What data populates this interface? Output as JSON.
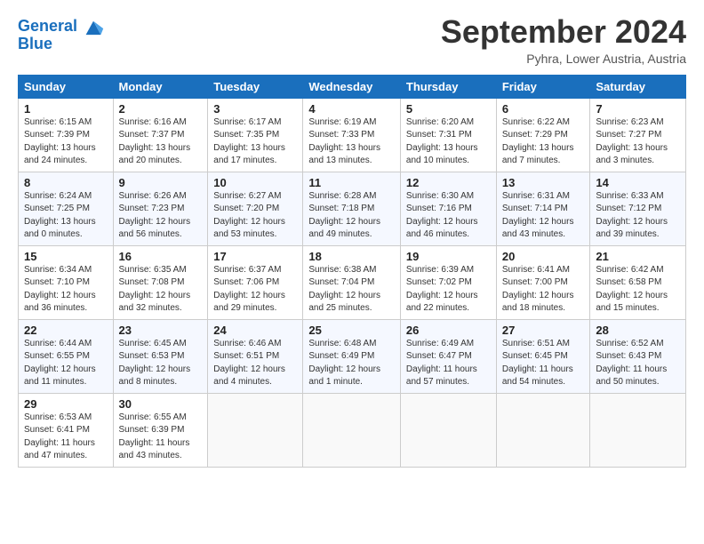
{
  "header": {
    "logo_line1": "General",
    "logo_line2": "Blue",
    "month_title": "September 2024",
    "location": "Pyhra, Lower Austria, Austria"
  },
  "columns": [
    "Sunday",
    "Monday",
    "Tuesday",
    "Wednesday",
    "Thursday",
    "Friday",
    "Saturday"
  ],
  "weeks": [
    [
      {
        "day": "1",
        "info": "Sunrise: 6:15 AM\nSunset: 7:39 PM\nDaylight: 13 hours\nand 24 minutes."
      },
      {
        "day": "2",
        "info": "Sunrise: 6:16 AM\nSunset: 7:37 PM\nDaylight: 13 hours\nand 20 minutes."
      },
      {
        "day": "3",
        "info": "Sunrise: 6:17 AM\nSunset: 7:35 PM\nDaylight: 13 hours\nand 17 minutes."
      },
      {
        "day": "4",
        "info": "Sunrise: 6:19 AM\nSunset: 7:33 PM\nDaylight: 13 hours\nand 13 minutes."
      },
      {
        "day": "5",
        "info": "Sunrise: 6:20 AM\nSunset: 7:31 PM\nDaylight: 13 hours\nand 10 minutes."
      },
      {
        "day": "6",
        "info": "Sunrise: 6:22 AM\nSunset: 7:29 PM\nDaylight: 13 hours\nand 7 minutes."
      },
      {
        "day": "7",
        "info": "Sunrise: 6:23 AM\nSunset: 7:27 PM\nDaylight: 13 hours\nand 3 minutes."
      }
    ],
    [
      {
        "day": "8",
        "info": "Sunrise: 6:24 AM\nSunset: 7:25 PM\nDaylight: 13 hours\nand 0 minutes."
      },
      {
        "day": "9",
        "info": "Sunrise: 6:26 AM\nSunset: 7:23 PM\nDaylight: 12 hours\nand 56 minutes."
      },
      {
        "day": "10",
        "info": "Sunrise: 6:27 AM\nSunset: 7:20 PM\nDaylight: 12 hours\nand 53 minutes."
      },
      {
        "day": "11",
        "info": "Sunrise: 6:28 AM\nSunset: 7:18 PM\nDaylight: 12 hours\nand 49 minutes."
      },
      {
        "day": "12",
        "info": "Sunrise: 6:30 AM\nSunset: 7:16 PM\nDaylight: 12 hours\nand 46 minutes."
      },
      {
        "day": "13",
        "info": "Sunrise: 6:31 AM\nSunset: 7:14 PM\nDaylight: 12 hours\nand 43 minutes."
      },
      {
        "day": "14",
        "info": "Sunrise: 6:33 AM\nSunset: 7:12 PM\nDaylight: 12 hours\nand 39 minutes."
      }
    ],
    [
      {
        "day": "15",
        "info": "Sunrise: 6:34 AM\nSunset: 7:10 PM\nDaylight: 12 hours\nand 36 minutes."
      },
      {
        "day": "16",
        "info": "Sunrise: 6:35 AM\nSunset: 7:08 PM\nDaylight: 12 hours\nand 32 minutes."
      },
      {
        "day": "17",
        "info": "Sunrise: 6:37 AM\nSunset: 7:06 PM\nDaylight: 12 hours\nand 29 minutes."
      },
      {
        "day": "18",
        "info": "Sunrise: 6:38 AM\nSunset: 7:04 PM\nDaylight: 12 hours\nand 25 minutes."
      },
      {
        "day": "19",
        "info": "Sunrise: 6:39 AM\nSunset: 7:02 PM\nDaylight: 12 hours\nand 22 minutes."
      },
      {
        "day": "20",
        "info": "Sunrise: 6:41 AM\nSunset: 7:00 PM\nDaylight: 12 hours\nand 18 minutes."
      },
      {
        "day": "21",
        "info": "Sunrise: 6:42 AM\nSunset: 6:58 PM\nDaylight: 12 hours\nand 15 minutes."
      }
    ],
    [
      {
        "day": "22",
        "info": "Sunrise: 6:44 AM\nSunset: 6:55 PM\nDaylight: 12 hours\nand 11 minutes."
      },
      {
        "day": "23",
        "info": "Sunrise: 6:45 AM\nSunset: 6:53 PM\nDaylight: 12 hours\nand 8 minutes."
      },
      {
        "day": "24",
        "info": "Sunrise: 6:46 AM\nSunset: 6:51 PM\nDaylight: 12 hours\nand 4 minutes."
      },
      {
        "day": "25",
        "info": "Sunrise: 6:48 AM\nSunset: 6:49 PM\nDaylight: 12 hours\nand 1 minute."
      },
      {
        "day": "26",
        "info": "Sunrise: 6:49 AM\nSunset: 6:47 PM\nDaylight: 11 hours\nand 57 minutes."
      },
      {
        "day": "27",
        "info": "Sunrise: 6:51 AM\nSunset: 6:45 PM\nDaylight: 11 hours\nand 54 minutes."
      },
      {
        "day": "28",
        "info": "Sunrise: 6:52 AM\nSunset: 6:43 PM\nDaylight: 11 hours\nand 50 minutes."
      }
    ],
    [
      {
        "day": "29",
        "info": "Sunrise: 6:53 AM\nSunset: 6:41 PM\nDaylight: 11 hours\nand 47 minutes."
      },
      {
        "day": "30",
        "info": "Sunrise: 6:55 AM\nSunset: 6:39 PM\nDaylight: 11 hours\nand 43 minutes."
      },
      {
        "day": "",
        "info": ""
      },
      {
        "day": "",
        "info": ""
      },
      {
        "day": "",
        "info": ""
      },
      {
        "day": "",
        "info": ""
      },
      {
        "day": "",
        "info": ""
      }
    ]
  ]
}
